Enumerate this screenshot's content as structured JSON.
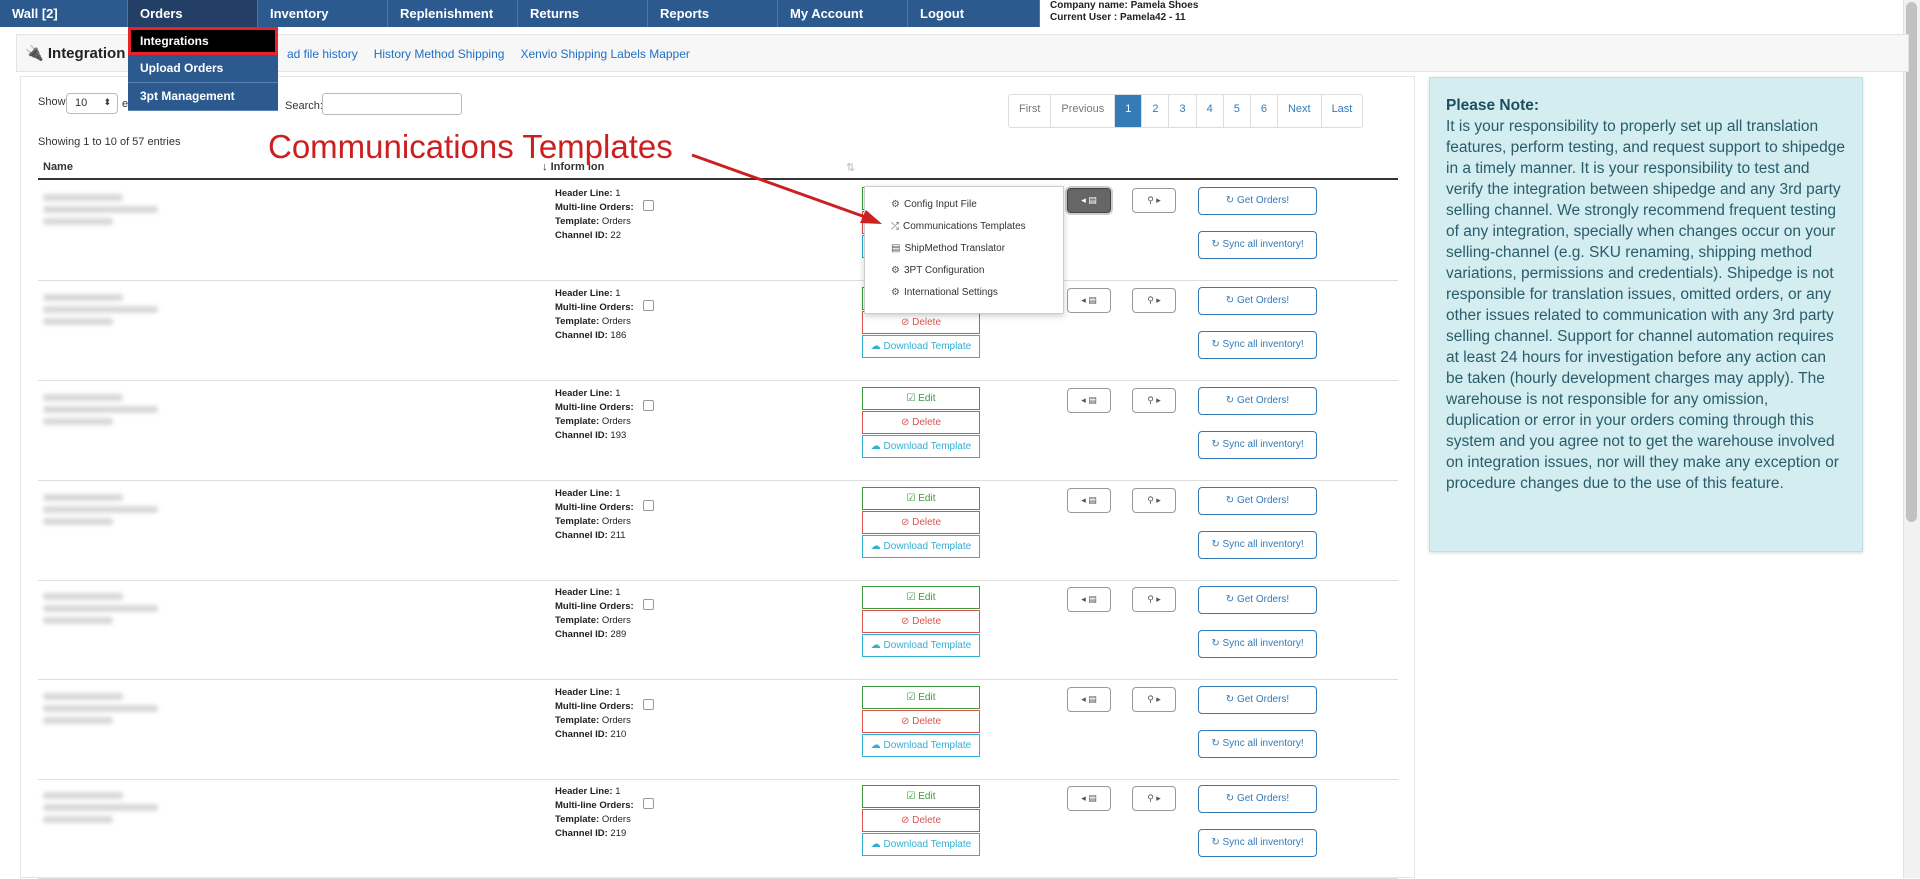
{
  "nav": [
    "Wall [2]",
    "Orders",
    "Inventory",
    "Replenishment",
    "Returns",
    "Reports",
    "My Account",
    "Logout"
  ],
  "company": {
    "name": "Company name: Pamela Shoes",
    "user": "Current User : Pamela42 - 11"
  },
  "orders_menu": [
    "Integrations",
    "Upload Orders",
    "3pt Management"
  ],
  "page_title": "Integration",
  "sub_links": [
    "ad file history",
    "History Method Shipping",
    "Xenvio Shipping Labels Mapper"
  ],
  "table_controls": {
    "show_label": "Show",
    "show_value": "10",
    "entries_label": "e",
    "search_label": "Search:",
    "showing": "Showing 1 to 10 of 57 entries"
  },
  "pagination": [
    "First",
    "Previous",
    "1",
    "2",
    "3",
    "4",
    "5",
    "6",
    "Next",
    "Last"
  ],
  "columns": {
    "name": "Name",
    "info": "Inform   ion",
    "sort": "⇅"
  },
  "annotation": "Communications Templates",
  "info_labels": {
    "header": "Header Line:",
    "multi": "Multi-line Orders:",
    "template": "Template:",
    "channel": "Channel ID:"
  },
  "rows": [
    {
      "header_line": "1",
      "template": "Orders",
      "channel_id": "22"
    },
    {
      "header_line": "1",
      "template": "Orders",
      "channel_id": "186"
    },
    {
      "header_line": "1",
      "template": "Orders",
      "channel_id": "193"
    },
    {
      "header_line": "1",
      "template": "Orders",
      "channel_id": "211"
    },
    {
      "header_line": "1",
      "template": "Orders",
      "channel_id": "289"
    },
    {
      "header_line": "1",
      "template": "Orders",
      "channel_id": "210"
    },
    {
      "header_line": "1",
      "template": "Orders",
      "channel_id": "219"
    }
  ],
  "buttons": {
    "edit": "☑ Edit",
    "delete": "⊘ Delete",
    "download": "☁ Download Template",
    "get_orders": "↻ Get Orders!",
    "sync": "↻ Sync all inventory!"
  },
  "popup_menu": [
    "Config Input File",
    "Communications Templates",
    "ShipMethod Translator",
    "3PT Configuration",
    "International Settings"
  ],
  "note": {
    "title": "Please Note:",
    "body": "It is your responsibility to properly set up all translation features, perform testing, and request support to shipedge in a timely manner. It is your responsibility to test and verify the integration between shipedge and any 3rd party selling channel. We strongly recommend frequent testing of any integration, specially when changes occur on your selling-channel (e.g. SKU renaming, shipping method variations, permissions and credentials). Shipedge is not responsible for translation issues, omitted orders, or any other issues related to communication with any 3rd party selling channel. Support for channel automation requires at least 24 hours for investigation before any action can be taken (hourly development charges may apply). The warehouse is not responsible for any omission, duplication or error in your orders coming through this system and you agree not to get the warehouse involved on integration issues, nor will they make any exception or procedure changes due to the use of this feature."
  },
  "colors": {
    "nav": "#2c5a8f",
    "accent_red": "#cc1f1f",
    "note_bg": "#d3edf0",
    "link": "#337ab7"
  }
}
